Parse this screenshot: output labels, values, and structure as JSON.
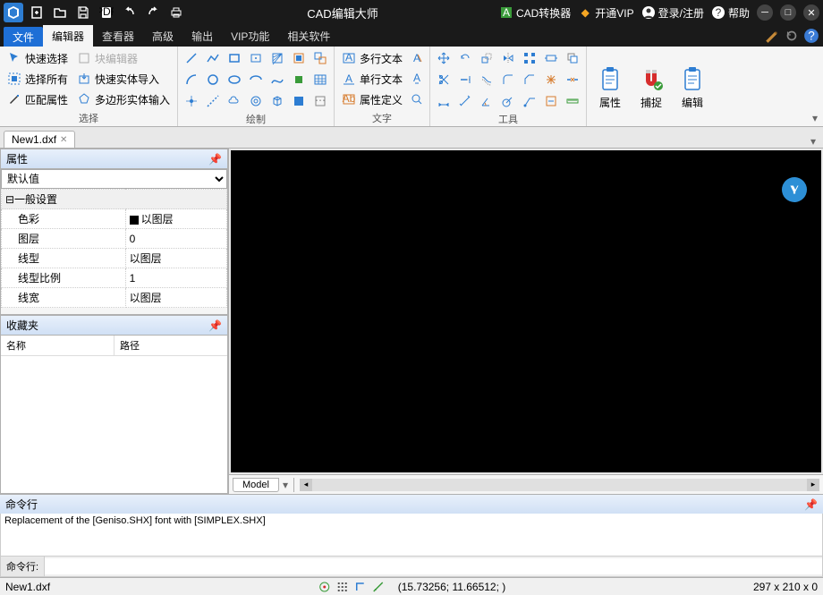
{
  "title": "CAD编辑大师",
  "titlebar_right": {
    "converter": "CAD转换器",
    "vip": "开通VIP",
    "login": "登录/注册",
    "help": "帮助"
  },
  "menu": {
    "file": "文件",
    "editor": "编辑器",
    "viewer": "查看器",
    "advanced": "高级",
    "output": "输出",
    "vip": "VIP功能",
    "related": "相关软件"
  },
  "ribbon": {
    "select": {
      "quick": "快速选择",
      "all": "选择所有",
      "match": "匹配属性",
      "block_edit": "块编辑器",
      "import_solid": "快速实体导入",
      "polygon_input": "多边形实体输入",
      "label": "选择"
    },
    "draw": {
      "label": "绘制"
    },
    "text": {
      "multiline": "多行文本",
      "singleline": "单行文本",
      "attr_def": "属性定义",
      "label": "文字"
    },
    "tools": {
      "label": "工具"
    },
    "big": {
      "props": "属性",
      "snap": "捕捉",
      "edit": "编辑"
    }
  },
  "filetab": "New1.dxf",
  "panels": {
    "props_title": "属性",
    "default_val": "默认值",
    "general": "一般设置",
    "rows": {
      "color_k": "色彩",
      "color_v": "以图层",
      "layer_k": "图层",
      "layer_v": "0",
      "linetype_k": "线型",
      "linetype_v": "以图层",
      "ltscale_k": "线型比例",
      "ltscale_v": "1",
      "lineweight_k": "线宽",
      "lineweight_v": "以图层"
    },
    "fav_title": "收藏夹",
    "fav_name": "名称",
    "fav_path": "路径"
  },
  "model_tab": "Model",
  "cmd": {
    "title": "命令行",
    "log": "Replacement of the [Geniso.SHX] font with [SIMPLEX.SHX]",
    "label": "命令行:"
  },
  "status": {
    "file": "New1.dxf",
    "coords": "(15.73256; 11.66512; )",
    "dims": "297 x 210 x 0"
  }
}
